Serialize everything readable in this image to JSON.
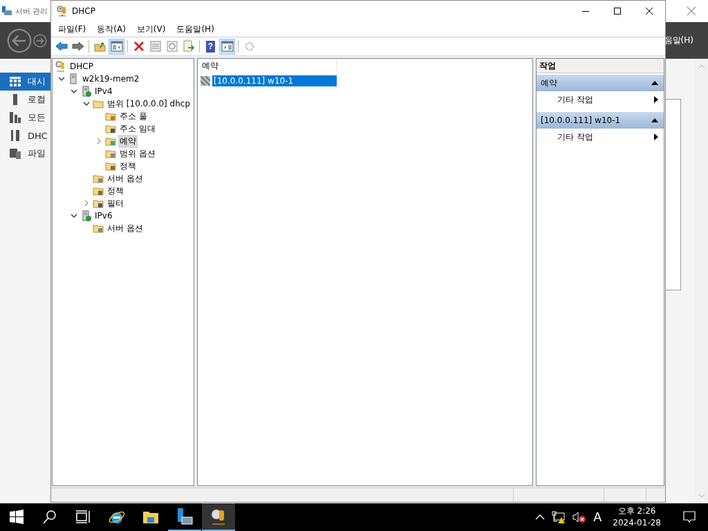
{
  "background_window": {
    "title": "서버 관리",
    "menu_fragment": "움말(H)",
    "sidebar": [
      {
        "label": "대시",
        "kind": "dashboard",
        "selected": true
      },
      {
        "label": "로컬",
        "kind": "local",
        "selected": false
      },
      {
        "label": "모든",
        "kind": "all",
        "selected": false
      },
      {
        "label": "DHC",
        "kind": "role",
        "selected": false
      },
      {
        "label": "파일",
        "kind": "files",
        "selected": false
      }
    ]
  },
  "window": {
    "title": "DHCP",
    "menu": [
      "파일(F)",
      "동작(A)",
      "보기(V)",
      "도움말(H)"
    ],
    "toolbar": [
      {
        "kind": "back",
        "pressed": false,
        "disabled": false
      },
      {
        "kind": "forward",
        "pressed": false,
        "disabled": false
      },
      {
        "kind": "separator"
      },
      {
        "kind": "up",
        "pressed": false,
        "disabled": false
      },
      {
        "kind": "tree",
        "pressed": true,
        "disabled": false
      },
      {
        "kind": "separator"
      },
      {
        "kind": "delete",
        "pressed": false,
        "disabled": false
      },
      {
        "kind": "properties",
        "pressed": false,
        "disabled": false
      },
      {
        "kind": "refresh",
        "pressed": false,
        "disabled": false
      },
      {
        "kind": "export",
        "pressed": false,
        "disabled": false
      },
      {
        "kind": "separator"
      },
      {
        "kind": "help",
        "label": "?",
        "pressed": false,
        "disabled": false
      },
      {
        "kind": "actionpane",
        "pressed": true,
        "disabled": false
      },
      {
        "kind": "separator"
      },
      {
        "kind": "gear",
        "pressed": false,
        "disabled": true
      }
    ],
    "tree": [
      {
        "label": "DHCP",
        "kind": "dhcp",
        "selected": false,
        "children": [
          {
            "label": "w2k19-mem2",
            "kind": "server",
            "expanded": true,
            "selected": false,
            "children": [
              {
                "label": "IPv4",
                "kind": "protocol",
                "expanded": true,
                "selected": false,
                "children": [
                  {
                    "label": "범위 [10.0.0.0] dhcp",
                    "kind": "folder",
                    "expanded": true,
                    "selected": false,
                    "children": [
                      {
                        "label": "주소 풀",
                        "kind": "pool",
                        "selected": false
                      },
                      {
                        "label": "주소 임대",
                        "kind": "lease",
                        "selected": false
                      },
                      {
                        "label": "예약",
                        "kind": "reservation",
                        "expanded": false,
                        "selected": true
                      },
                      {
                        "label": "범위 옵션",
                        "kind": "options",
                        "selected": false
                      },
                      {
                        "label": "정책",
                        "kind": "policy",
                        "selected": false
                      }
                    ]
                  },
                  {
                    "label": "서버 옵션",
                    "kind": "options",
                    "selected": false
                  },
                  {
                    "label": "정책",
                    "kind": "policy",
                    "selected": false
                  },
                  {
                    "label": "필터",
                    "kind": "filter",
                    "expanded": false,
                    "selected": false
                  }
                ]
              },
              {
                "label": "IPv6",
                "kind": "protocol",
                "expanded": true,
                "selected": false,
                "children": [
                  {
                    "label": "서버 옵션",
                    "kind": "options",
                    "selected": false
                  }
                ]
              }
            ]
          }
        ]
      }
    ],
    "list": {
      "column": "예약",
      "rows": [
        {
          "label": "[10.0.0.111] w10-1",
          "selected": true
        }
      ]
    },
    "actions": {
      "title": "작업",
      "sections": [
        {
          "title": "예약",
          "expanded": true,
          "items": [
            "기타 작업"
          ]
        },
        {
          "title": "[10.0.0.111] w10-1",
          "expanded": true,
          "items": [
            "기타 작업"
          ]
        }
      ]
    }
  },
  "taskbar": {
    "apps": [
      {
        "kind": "start",
        "running": false,
        "active": false
      },
      {
        "kind": "search",
        "running": false,
        "active": false
      },
      {
        "kind": "taskview",
        "running": false,
        "active": false
      },
      {
        "kind": "ie",
        "running": false,
        "active": false
      },
      {
        "kind": "explorer",
        "running": false,
        "active": false
      },
      {
        "kind": "servermanager",
        "running": true,
        "active": false
      },
      {
        "kind": "dhcp",
        "running": true,
        "active": true
      }
    ],
    "tray": {
      "input_indicator": "A",
      "time": "오후 2:26",
      "date": "2024-01-28"
    }
  }
}
